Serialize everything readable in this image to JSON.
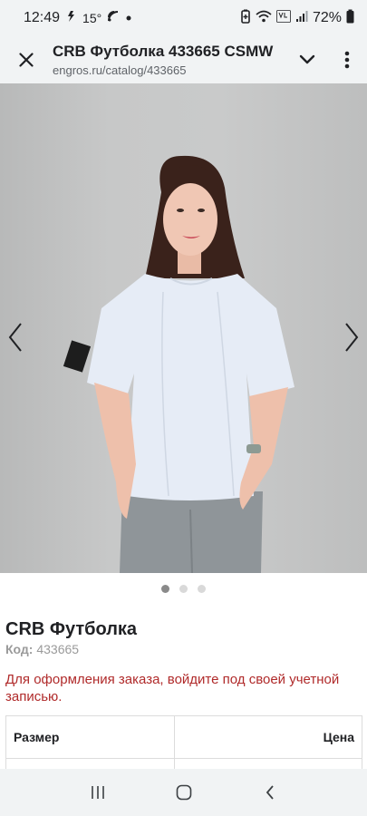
{
  "status_bar": {
    "time": "12:49",
    "temperature": "15°",
    "battery": "72%",
    "icons": [
      "weather-icon",
      "nfc-icon",
      "notification-dot-icon",
      "battery-saver-icon",
      "wifi-icon",
      "volte-icon",
      "signal-icon",
      "battery-icon"
    ]
  },
  "tab": {
    "title": "CRB Футболка 433665 CSMW",
    "url": "engros.ru/catalog/433665"
  },
  "carousel": {
    "slide_count": 3,
    "active_index": 0
  },
  "product": {
    "name": "CRB Футболка",
    "code_label": "Код:",
    "code_value": "433665",
    "login_note": "Для оформления заказа, войдите под своей учетной записью."
  },
  "table": {
    "headers": [
      "Размер",
      "Цена"
    ]
  },
  "colors": {
    "chrome_bg": "#f1f3f4",
    "warning_text": "#b02a2a",
    "muted_text": "#9a9a9a"
  }
}
